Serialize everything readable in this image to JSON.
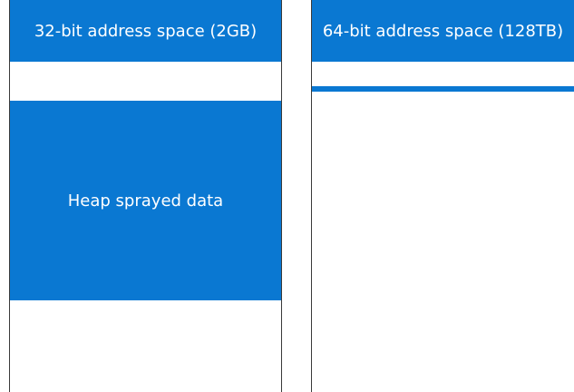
{
  "diagram": {
    "panels": [
      {
        "title": "32-bit address space (2GB)",
        "block_label": "Heap sprayed data"
      },
      {
        "title": "64-bit address space (128TB)"
      }
    ],
    "colors": {
      "accent": "#0a78d2",
      "background": "#ffffff",
      "border": "#3a3a3a",
      "text_on_accent": "#ffffff"
    }
  }
}
